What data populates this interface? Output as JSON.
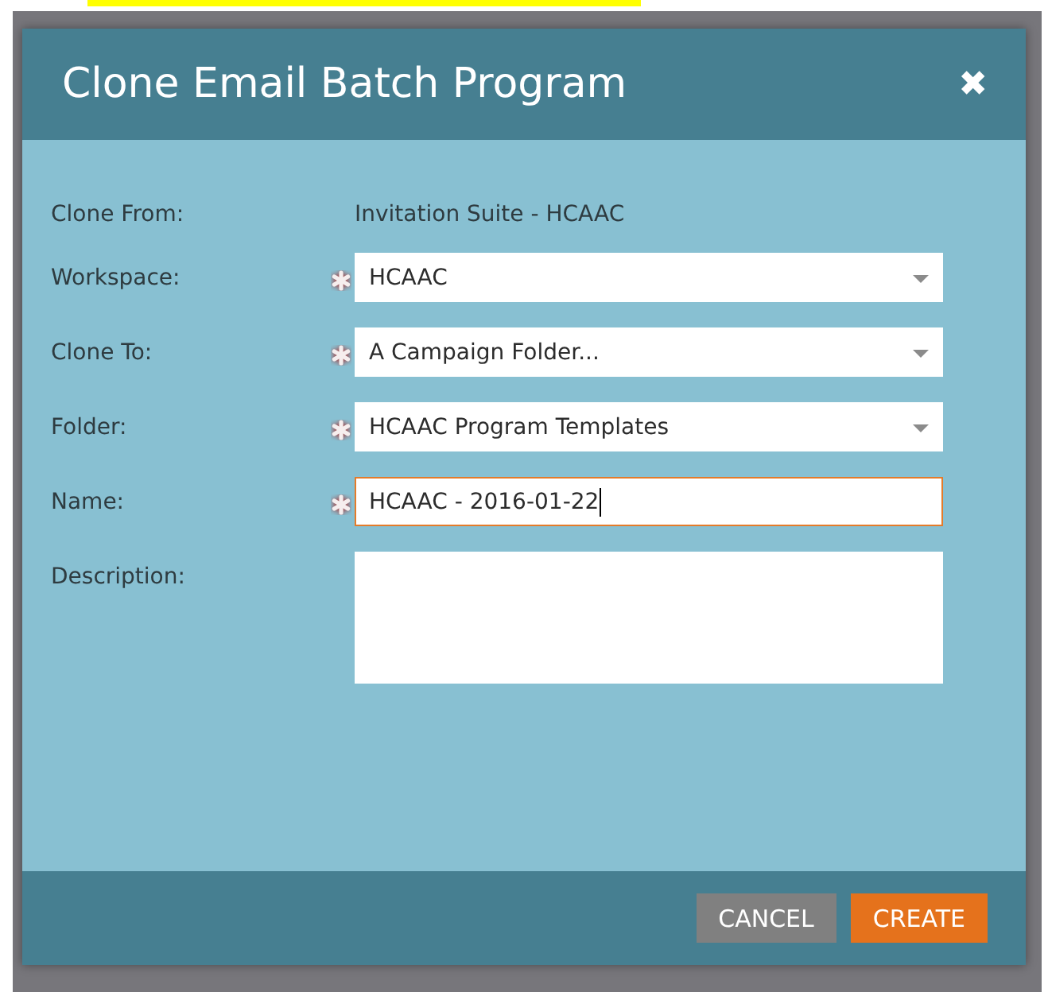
{
  "dialog": {
    "title": "Clone Email Batch Program",
    "close_icon": "✖"
  },
  "fields": [
    {
      "label": "Clone From:",
      "kind": "static",
      "value": "Invitation Suite - HCAAC",
      "required": false
    },
    {
      "label": "Workspace:",
      "kind": "select",
      "value": "HCAAC",
      "required": true
    },
    {
      "label": "Clone To:",
      "kind": "select",
      "value": "A Campaign Folder...",
      "required": true
    },
    {
      "label": "Folder:",
      "kind": "select",
      "value": "HCAAC Program Templates",
      "required": true
    },
    {
      "label": "Name:",
      "kind": "text",
      "value": "HCAAC - 2016-01-22",
      "required": true,
      "focused": true
    },
    {
      "label": "Description:",
      "kind": "textarea",
      "required": false
    }
  ],
  "buttons": [
    {
      "label": "CANCEL",
      "kind": "secondary"
    },
    {
      "label": "CREATE",
      "kind": "primary"
    }
  ]
}
